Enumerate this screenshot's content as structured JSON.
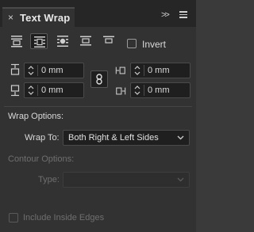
{
  "panel": {
    "title": "Text Wrap",
    "close_glyph": "×",
    "collapse_glyph": ">>"
  },
  "wrap_buttons": [
    {
      "icon": "no-text-wrap-icon",
      "selected": false
    },
    {
      "icon": "wrap-around-bounding-box-icon",
      "selected": true
    },
    {
      "icon": "wrap-around-object-shape-icon",
      "selected": false
    },
    {
      "icon": "jump-object-icon",
      "selected": false
    },
    {
      "icon": "jump-to-next-column-icon",
      "selected": false
    }
  ],
  "invert": {
    "label": "Invert",
    "checked": false
  },
  "offsets": {
    "top": "0 mm",
    "bottom": "0 mm",
    "left": "0 mm",
    "right": "0 mm"
  },
  "wrap_options": {
    "heading": "Wrap Options:",
    "wrap_to_label": "Wrap To:",
    "wrap_to_value": "Both Right & Left Sides"
  },
  "contour_options": {
    "heading": "Contour Options:",
    "type_label": "Type:",
    "type_value": ""
  },
  "include_inside_edges": {
    "label": "Include Inside Edges",
    "checked": false
  },
  "colors": {
    "panel_bg": "#323232",
    "field_bg": "#1f1f1f",
    "text": "#d9d9d9",
    "disabled_text": "#6f6f6f"
  }
}
